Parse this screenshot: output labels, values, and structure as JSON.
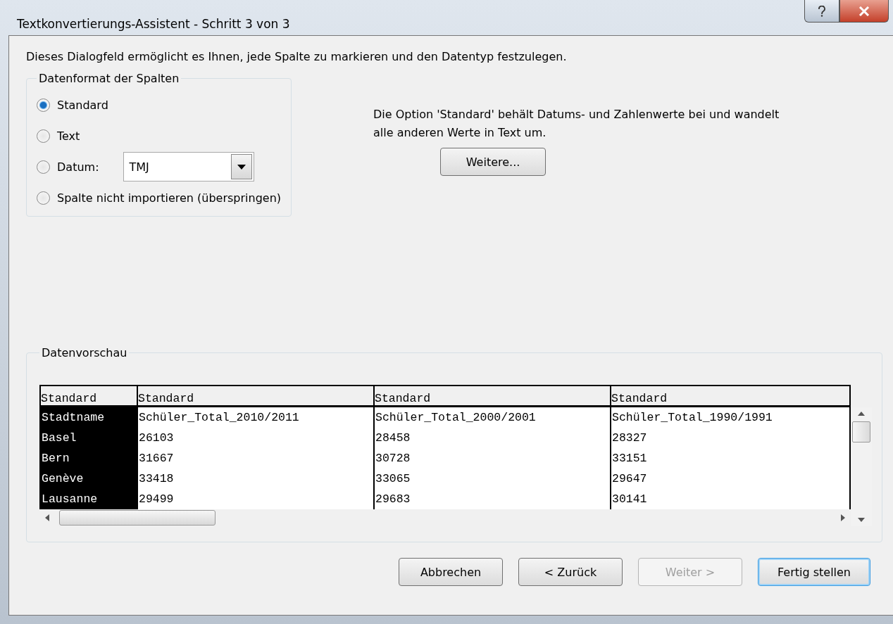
{
  "window": {
    "title": "Textkonvertierungs-Assistent - Schritt 3 von 3"
  },
  "intro": "Dieses Dialogfeld ermöglicht es Ihnen, jede Spalte zu markieren und den Datentyp festzulegen.",
  "format_group": {
    "legend": "Datenformat der Spalten",
    "options": [
      {
        "label": "Standard",
        "selected": true,
        "kind": "plain"
      },
      {
        "label": "Text",
        "selected": false,
        "kind": "plain"
      },
      {
        "label": "Datum:",
        "selected": false,
        "kind": "date",
        "select_value": "TMJ"
      },
      {
        "label": "Spalte nicht importieren (überspringen)",
        "selected": false,
        "kind": "plain"
      }
    ]
  },
  "description": "Die Option 'Standard' behält Datums- und Zahlenwerte bei und wandelt alle anderen Werte in Text um.",
  "more_button": "Weitere...",
  "preview": {
    "legend": "Datenvorschau",
    "columns": [
      {
        "header": "Standard",
        "selected": true
      },
      {
        "header": "Standard",
        "selected": false
      },
      {
        "header": "Standard",
        "selected": false
      },
      {
        "header": "Standard",
        "selected": false
      }
    ],
    "rows": [
      [
        "Stadtname",
        "Schüler_Total_2010/2011",
        "Schüler_Total_2000/2001",
        "Schüler_Total_1990/1991"
      ],
      [
        "Basel",
        "26103",
        "28458",
        "28327"
      ],
      [
        "Bern",
        "31667",
        "30728",
        "33151"
      ],
      [
        "Genève",
        "33418",
        "33065",
        "29647"
      ],
      [
        "Lausanne",
        "29499",
        "29683",
        "30141"
      ]
    ]
  },
  "buttons": [
    {
      "label": "Abbrechen",
      "disabled": false,
      "default": false
    },
    {
      "label": "< Zurück",
      "disabled": false,
      "default": false
    },
    {
      "label": "Weiter >",
      "disabled": true,
      "default": false
    },
    {
      "label": "Fertig stellen",
      "disabled": false,
      "default": true
    }
  ]
}
